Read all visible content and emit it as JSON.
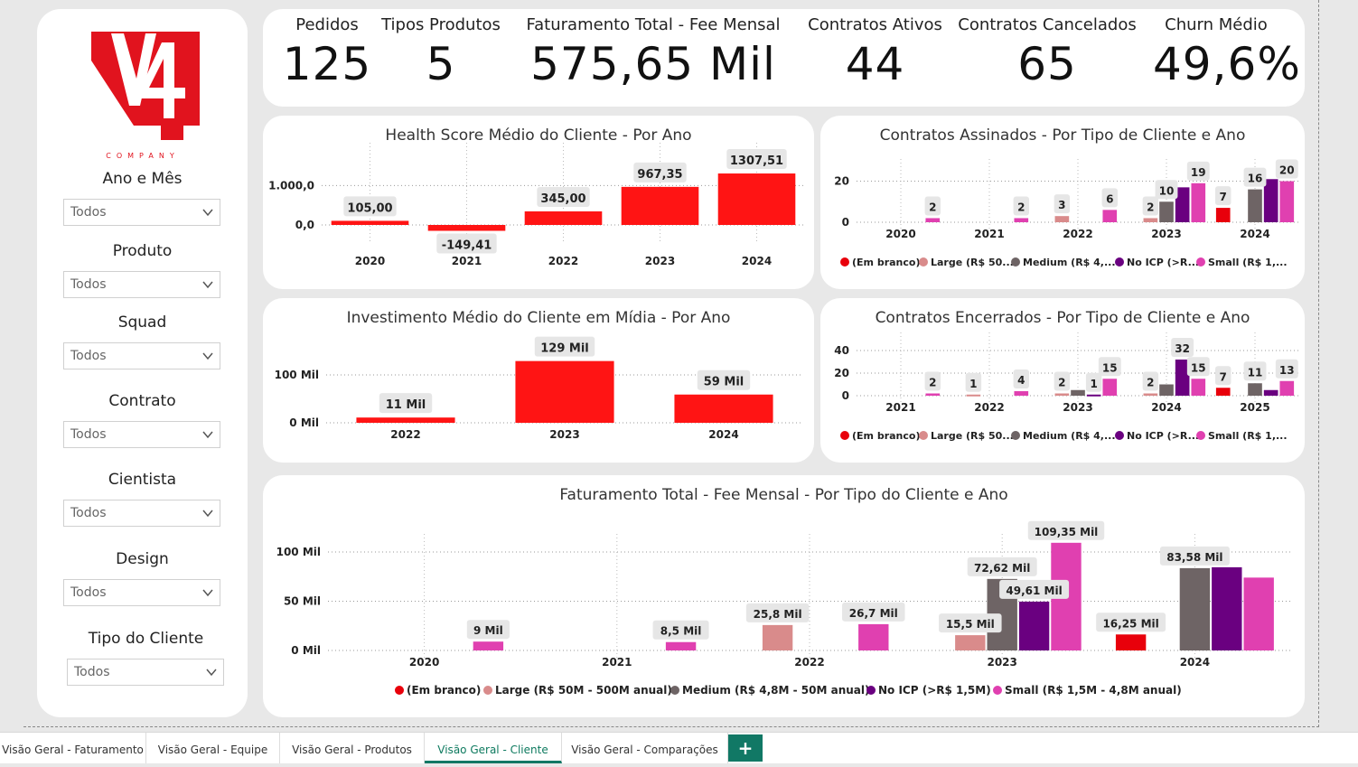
{
  "sidebar": {
    "logo_text": "COMPANY",
    "logo_number": "V4",
    "filters": [
      {
        "label": "Ano e Mês",
        "value": "Todos"
      },
      {
        "label": "Produto",
        "value": "Todos"
      },
      {
        "label": "Squad",
        "value": "Todos"
      },
      {
        "label": "Contrato",
        "value": "Todos"
      },
      {
        "label": "Cientista",
        "value": "Todos"
      },
      {
        "label": "Design",
        "value": "Todos"
      },
      {
        "label": "Tipo do Cliente",
        "value": "Todos"
      }
    ]
  },
  "kpis": [
    {
      "label": "Pedidos",
      "value": "125"
    },
    {
      "label": "Tipos Produtos",
      "value": "5"
    },
    {
      "label": "Faturamento Total - Fee Mensal",
      "value": "575,65 Mil"
    },
    {
      "label": "Contratos Ativos",
      "value": "44"
    },
    {
      "label": "Contratos Cancelados",
      "value": "65"
    },
    {
      "label": "Churn Médio",
      "value": "49,6%"
    }
  ],
  "colors": {
    "em_branco": "#e8000b",
    "large": "#d98b8b",
    "medium": "#6e6465",
    "no_icp": "#6a0080",
    "small": "#e040b0",
    "red_bar": "#ff1414"
  },
  "chart_data": [
    {
      "id": "health",
      "type": "bar",
      "title": "Health Score Médio do Cliente - Por Ano",
      "categories": [
        "2020",
        "2021",
        "2022",
        "2023",
        "2024"
      ],
      "values": [
        105.0,
        -149.41,
        345.0,
        967.35,
        1307.51
      ],
      "labels": [
        "105,00",
        "-149,41",
        "345,00",
        "967,35",
        "1307,51"
      ],
      "yticks": [
        "1.000,0",
        "0,0"
      ],
      "ylim": [
        -200,
        1400
      ]
    },
    {
      "id": "investimento",
      "type": "bar",
      "title": "Investimento Médio do Cliente em Mídia - Por Ano",
      "categories": [
        "2022",
        "2023",
        "2024"
      ],
      "values": [
        11000,
        129000,
        59000
      ],
      "labels": [
        "11 Mil",
        "129 Mil",
        "59 Mil"
      ],
      "yticks": [
        "100 Mil",
        "0 Mil"
      ],
      "ylim": [
        0,
        130000
      ]
    },
    {
      "id": "assinados",
      "type": "bar",
      "title": "Contratos Assinados - Por Tipo de Cliente e Ano",
      "categories": [
        "2020",
        "2021",
        "2022",
        "2023",
        "2024"
      ],
      "yticks": [
        "20",
        "0"
      ],
      "ylim": [
        0,
        22
      ],
      "series": [
        {
          "name": "(Em branco)",
          "values": [
            null,
            null,
            null,
            null,
            7
          ]
        },
        {
          "name": "Large  (R$ 50...",
          "values": [
            null,
            null,
            3,
            2,
            null
          ]
        },
        {
          "name": "Medium (R$ 4,...",
          "values": [
            null,
            null,
            null,
            10,
            16
          ]
        },
        {
          "name": "No ICP (>R...",
          "values": [
            null,
            null,
            null,
            17,
            21
          ]
        },
        {
          "name": "Small (R$ 1,...",
          "values": [
            2,
            2,
            6,
            19,
            20
          ]
        }
      ],
      "labels": [
        {
          "cat": 0,
          "series": 4,
          "text": "2"
        },
        {
          "cat": 1,
          "series": 4,
          "text": "2"
        },
        {
          "cat": 2,
          "series": 1,
          "text": "3"
        },
        {
          "cat": 2,
          "series": 4,
          "text": "6"
        },
        {
          "cat": 3,
          "series": 1,
          "text": "2"
        },
        {
          "cat": 3,
          "series": 2,
          "text": "10"
        },
        {
          "cat": 3,
          "series": 4,
          "text": "19"
        },
        {
          "cat": 4,
          "series": 0,
          "text": "7"
        },
        {
          "cat": 4,
          "series": 2,
          "text": "16"
        },
        {
          "cat": 4,
          "series": 4,
          "text": "20"
        }
      ]
    },
    {
      "id": "encerrados",
      "type": "bar",
      "title": "Contratos Encerrados - Por Tipo de Cliente e Ano",
      "categories": [
        "2021",
        "2022",
        "2023",
        "2024",
        "2025"
      ],
      "yticks": [
        "40",
        "20",
        "0"
      ],
      "ylim": [
        0,
        40
      ],
      "series": [
        {
          "name": "(Em branco)",
          "values": [
            null,
            null,
            null,
            null,
            7
          ]
        },
        {
          "name": "Large  (R$ 50...",
          "values": [
            null,
            1,
            2,
            2,
            null
          ]
        },
        {
          "name": "Medium (R$ 4,...",
          "values": [
            null,
            null,
            5,
            10,
            11
          ]
        },
        {
          "name": "No ICP (>R...",
          "values": [
            null,
            null,
            1,
            32,
            5
          ]
        },
        {
          "name": "Small (R$ 1,...",
          "values": [
            2,
            4,
            15,
            15,
            13
          ]
        }
      ],
      "labels": [
        {
          "cat": 0,
          "series": 4,
          "text": "2"
        },
        {
          "cat": 1,
          "series": 1,
          "text": "1"
        },
        {
          "cat": 1,
          "series": 4,
          "text": "4"
        },
        {
          "cat": 2,
          "series": 1,
          "text": "2"
        },
        {
          "cat": 2,
          "series": 3,
          "text": "1"
        },
        {
          "cat": 2,
          "series": 4,
          "text": "15"
        },
        {
          "cat": 3,
          "series": 1,
          "text": "2"
        },
        {
          "cat": 3,
          "series": 3,
          "text": "32"
        },
        {
          "cat": 3,
          "series": 4,
          "text": "15"
        },
        {
          "cat": 4,
          "series": 0,
          "text": "7"
        },
        {
          "cat": 4,
          "series": 2,
          "text": "11"
        },
        {
          "cat": 4,
          "series": 4,
          "text": "13"
        }
      ]
    },
    {
      "id": "faturamento",
      "type": "bar",
      "title": "Faturamento Total - Fee Mensal - Por Tipo do Cliente e Ano",
      "categories": [
        "2020",
        "2021",
        "2022",
        "2023",
        "2024"
      ],
      "yticks": [
        "100 Mil",
        "50 Mil",
        "0 Mil"
      ],
      "ylim": [
        0,
        120000
      ],
      "series": [
        {
          "name": "(Em branco)",
          "values": [
            null,
            null,
            null,
            null,
            16250
          ]
        },
        {
          "name": "Large  (R$ 50M - 500M anual)",
          "values": [
            null,
            null,
            25800,
            15500,
            null
          ]
        },
        {
          "name": "Medium (R$ 4,8M - 50M anual)",
          "values": [
            null,
            null,
            null,
            72620,
            83580
          ]
        },
        {
          "name": "No ICP (>R$ 1,5M)",
          "values": [
            null,
            null,
            null,
            49610,
            84500
          ]
        },
        {
          "name": "Small (R$ 1,5M - 4,8M anual)",
          "values": [
            9000,
            8500,
            26700,
            109350,
            74000
          ]
        }
      ],
      "labels": [
        {
          "cat": 0,
          "series": 4,
          "text": "9 Mil"
        },
        {
          "cat": 1,
          "series": 4,
          "text": "8,5 Mil"
        },
        {
          "cat": 2,
          "series": 1,
          "text": "25,8 Mil"
        },
        {
          "cat": 2,
          "series": 4,
          "text": "26,7 Mil"
        },
        {
          "cat": 3,
          "series": 1,
          "text": "15,5 Mil"
        },
        {
          "cat": 3,
          "series": 2,
          "text": "72,62 Mil"
        },
        {
          "cat": 3,
          "series": 3,
          "text": "49,61 Mil"
        },
        {
          "cat": 3,
          "series": 4,
          "text": "109,35 Mil"
        },
        {
          "cat": 4,
          "series": 0,
          "text": "16,25 Mil"
        },
        {
          "cat": 4,
          "series": 2,
          "text": "83,58 Mil"
        }
      ]
    }
  ],
  "tabs": [
    {
      "label": "Visão Geral - Faturamento",
      "active": false
    },
    {
      "label": "Visão Geral - Equipe",
      "active": false
    },
    {
      "label": "Visão Geral - Produtos",
      "active": false
    },
    {
      "label": "Visão Geral - Cliente",
      "active": true
    },
    {
      "label": "Visão Geral - Comparações",
      "active": false
    }
  ],
  "add_tab_label": "+"
}
